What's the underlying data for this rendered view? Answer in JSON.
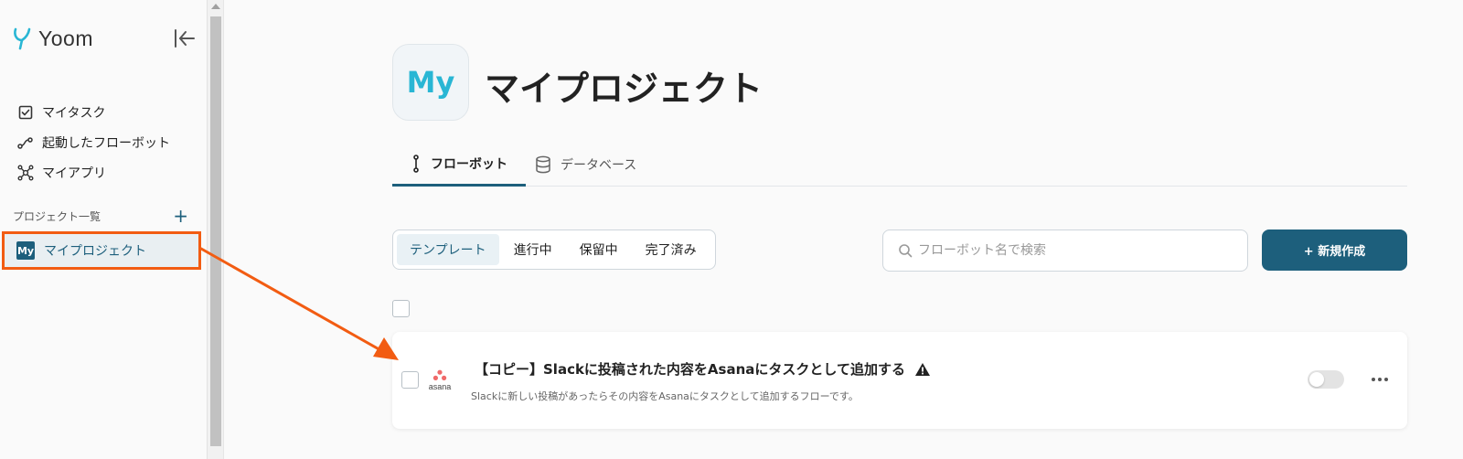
{
  "app": {
    "name": "Yoom"
  },
  "sidebar": {
    "nav": [
      {
        "label": "マイタスク",
        "icon": "checkbox-icon"
      },
      {
        "label": "起動したフローボット",
        "icon": "flow-icon"
      },
      {
        "label": "マイアプリ",
        "icon": "apps-icon"
      }
    ],
    "projects_heading": "プロジェクト一覧",
    "add_symbol": "+",
    "project": {
      "badge": "My",
      "label": "マイプロジェクト"
    }
  },
  "header": {
    "icon_text": "My",
    "title": "マイプロジェクト"
  },
  "tabs": [
    {
      "label": "フローボット",
      "active": true
    },
    {
      "label": "データベース",
      "active": false
    }
  ],
  "filters": [
    {
      "label": "テンプレート",
      "active": true
    },
    {
      "label": "進行中"
    },
    {
      "label": "保留中"
    },
    {
      "label": "完了済み"
    }
  ],
  "search": {
    "placeholder": "フローボット名で検索"
  },
  "new_button": "+ 新規作成",
  "flows": [
    {
      "app_logo": "asana",
      "title": "【コピー】Slackに投稿された内容をAsanaにタスクとして追加する",
      "description": "Slackに新しい投稿があったらその内容をAsanaにタスクとして追加するフローです。",
      "warning": true,
      "enabled": false
    }
  ],
  "colors": {
    "brand": "#1d5f7c",
    "logo_accent": "#29b6d4",
    "highlight": "#f25c12",
    "asana_dots": "#f06a6a"
  }
}
